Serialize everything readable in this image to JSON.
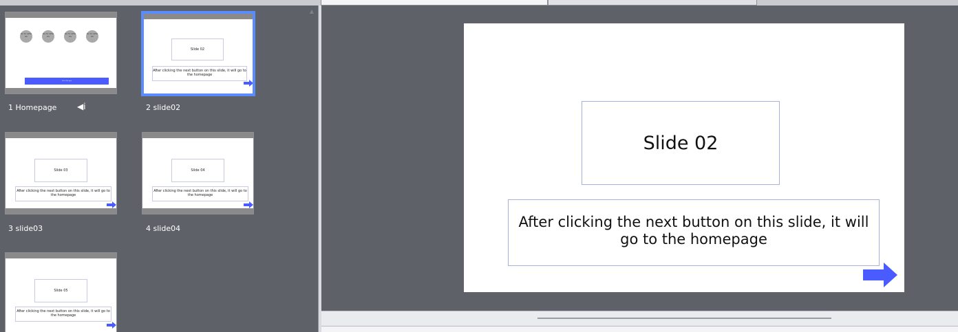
{
  "filmstrip": {
    "slides": [
      {
        "label": "1 Homepage",
        "has_audio": true,
        "selected": false,
        "buttons": [
          "Go to slide 02",
          "Go to slide 03",
          "Go to slide 04",
          "Go to slide 05"
        ],
        "cta": "Go to the quiz"
      },
      {
        "label": "2 slide02",
        "title": "Slide 02",
        "body": "After clicking the next button on this slide, it will go to the homepage",
        "selected": true
      },
      {
        "label": "3 slide03",
        "title": "Slide 03",
        "body": "After clicking the next button on this slide, it will go to the homepage",
        "selected": false
      },
      {
        "label": "4 slide04",
        "title": "Slide 04",
        "body": "After clicking the next button on this slide, it will go to the homepage",
        "selected": false
      },
      {
        "label": "",
        "title": "Slide 05",
        "body": "After clicking the next button on this slide, it will go to the homepage",
        "selected": false
      }
    ]
  },
  "slide_canvas": {
    "title": "Slide 02",
    "body_line1": "After clicking the next button on this slide, it will",
    "body_line2": "go to the homepage",
    "next_icon": "arrow-right-icon"
  },
  "icons": {
    "audio": "speaker-icon",
    "scroll_up": "scroll-up-arrow-icon"
  },
  "colors": {
    "selection": "#5b8cff",
    "arrow": "#4a5cff",
    "panel_bg": "#5e6168"
  }
}
